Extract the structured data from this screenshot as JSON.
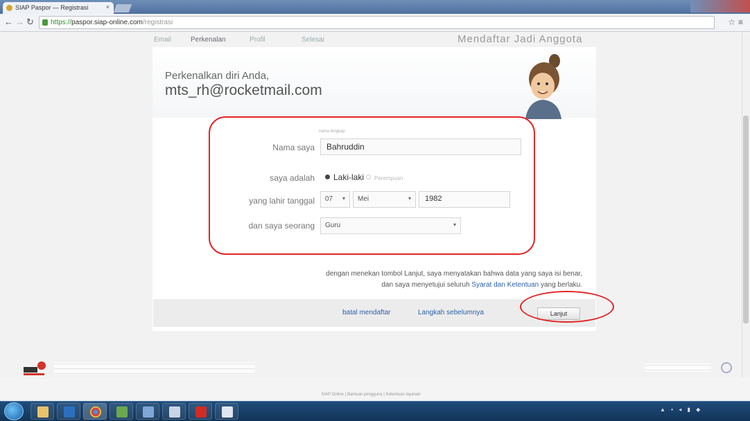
{
  "browser": {
    "tab_title": "SIAP Paspor — Registrasi",
    "tab_close": "×",
    "url_https": "https://",
    "url_host": "paspor.siap-online.com",
    "url_path": "/registrasi"
  },
  "steps": {
    "items": [
      "Email",
      "Perkenalan",
      "Profil",
      "Selesai"
    ],
    "active_index": 1,
    "title": "Mendaftar Jadi Anggota"
  },
  "intro": {
    "greeting": "Perkenalkan diri Anda,",
    "email": "mts_rh@rocketmail.com"
  },
  "form": {
    "name_label": "Nama saya",
    "name_value": "Bahruddin",
    "gender_label": "saya adalah",
    "gender_options": [
      "Laki-laki",
      "Perempuan"
    ],
    "gender_selected": "Laki-laki",
    "dob_label": "yang lahir tanggal",
    "dob_day": "07",
    "dob_month": "Mei",
    "dob_year": "1982",
    "job_label": "dan saya seorang",
    "job_value": "Guru"
  },
  "terms": {
    "line1": "dengan menekan tombol Lanjut, saya menyatakan bahwa data yang saya isi benar,",
    "line2_pre": "dan saya menyetujui seluruh",
    "link": "Syarat dan Ketentuan",
    "line2_post": "yang berlaku."
  },
  "actions": {
    "cancel": "batal mendaftar",
    "back": "Langkah sebelumnya",
    "next": "Lanjut"
  },
  "footer": {
    "links": "SIAP Online | Bantuan pengguna | Ketentuan layanan"
  },
  "colors": {
    "annotation_red": "#e32526",
    "link_blue": "#2a5fa8"
  }
}
